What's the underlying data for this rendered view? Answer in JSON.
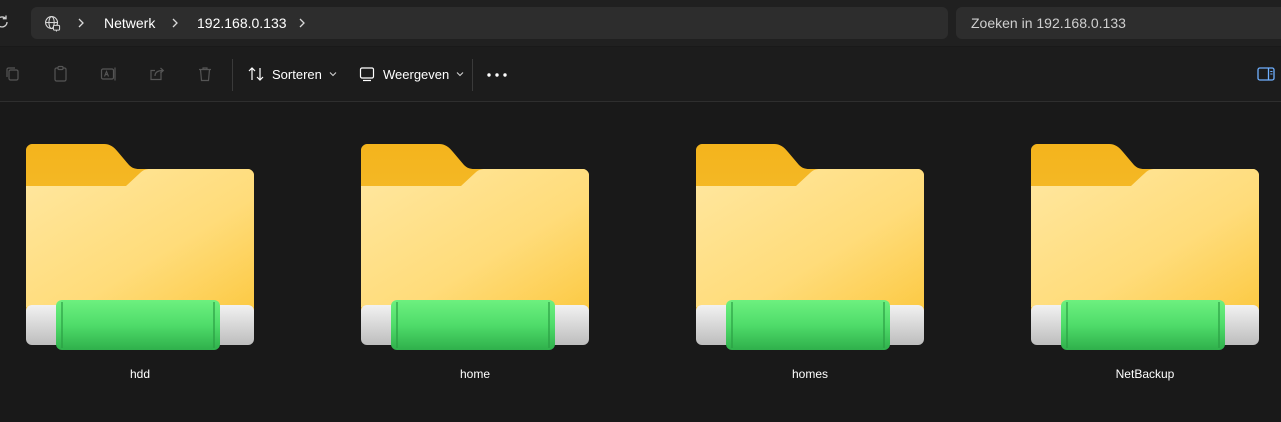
{
  "address": {
    "breadcrumb": [
      "Netwerk",
      "192.168.0.133"
    ],
    "search_placeholder": "Zoeken in 192.168.0.133"
  },
  "toolbar": {
    "sort_label": "Sorteren",
    "view_label": "Weergeven",
    "icons": [
      "copy-icon",
      "paste-icon",
      "rename-icon",
      "share-icon",
      "delete-icon",
      "sort-icon",
      "view-icon",
      "more-icon",
      "details-pane-icon"
    ]
  },
  "folders": [
    {
      "name": "hdd"
    },
    {
      "name": "home"
    },
    {
      "name": "homes"
    },
    {
      "name": "NetBackup"
    }
  ],
  "colors": {
    "background": "#191919",
    "bar": "#2d2d2d",
    "folder_back": "#f6bd2a",
    "folder_front": "#ffe08a",
    "share_bar": "#4fdc6a"
  }
}
